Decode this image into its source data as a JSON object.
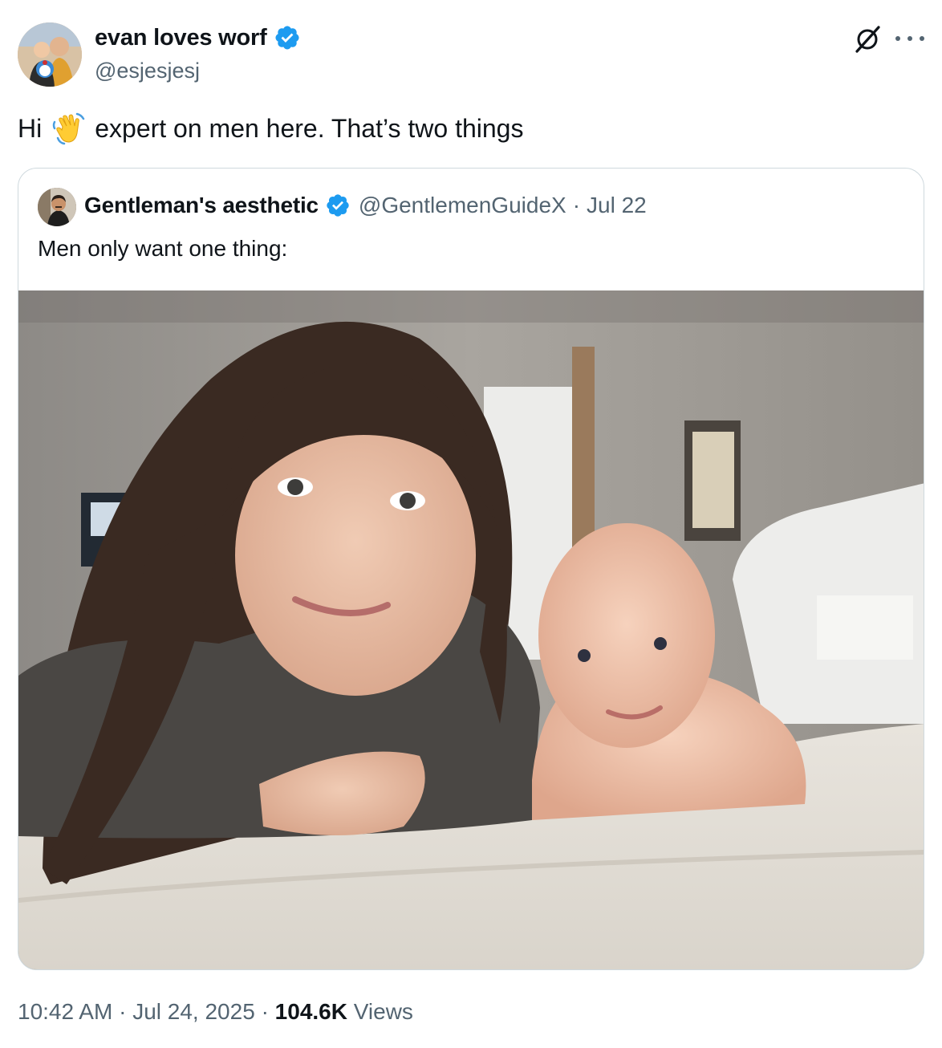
{
  "author": {
    "display_name": "evan loves worf",
    "handle": "@esjesjesj",
    "verified": true,
    "avatar_icon": "user-avatar"
  },
  "tweet": {
    "text_before": "Hi",
    "emoji": "waving-hand",
    "text_after": "expert on men here. That’s two things"
  },
  "quoted_tweet": {
    "display_name": "Gentleman's aesthetic",
    "handle": "@GentlemenGuideX",
    "separator": "·",
    "date": "Jul 22",
    "verified": true,
    "text": "Men only want one thing:",
    "media": "photo"
  },
  "footer": {
    "time": "10:42 AM",
    "separator": "·",
    "date": "Jul 24, 2025",
    "views_count": "104.6K",
    "views_label": "Views"
  },
  "icons": {
    "grok": "grok-icon",
    "more": "more-icon"
  },
  "colors": {
    "text_primary": "#0f1419",
    "text_secondary": "#536471",
    "verified_blue": "#1d9bf0",
    "border": "#cfd9de"
  }
}
